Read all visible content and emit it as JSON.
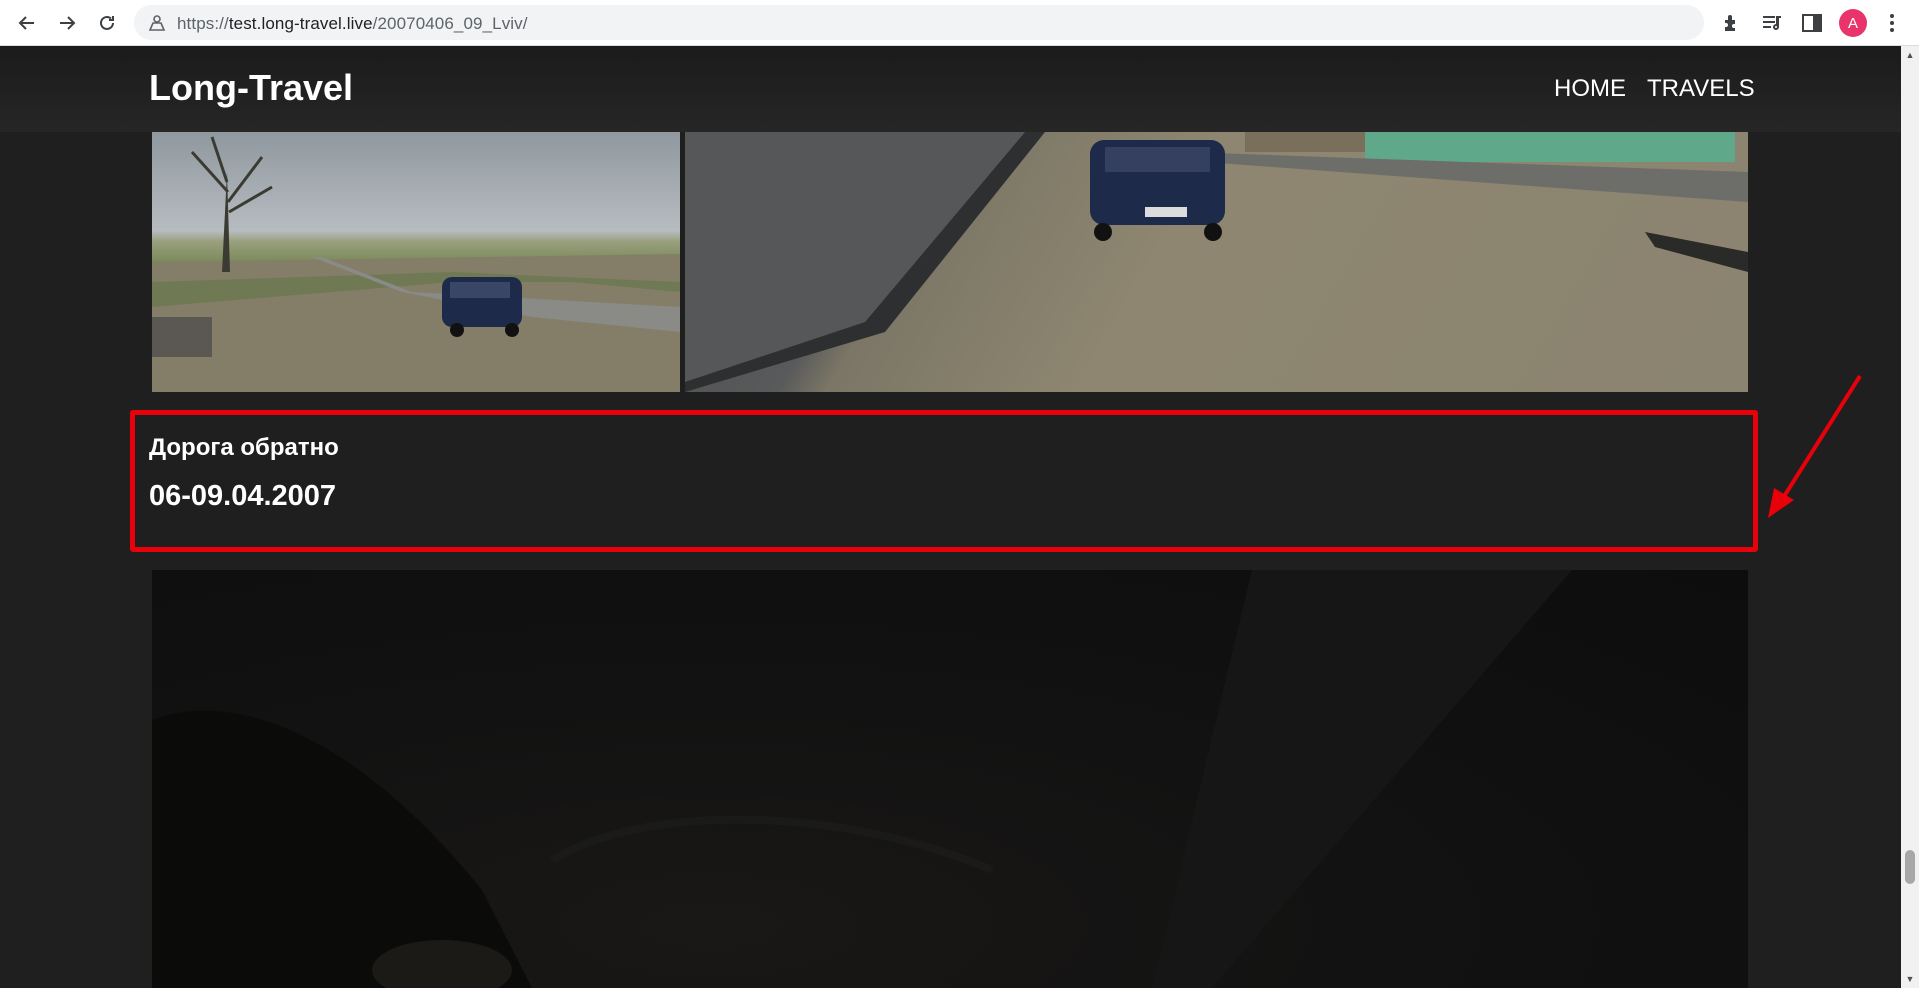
{
  "browser": {
    "url_prefix": "https://",
    "url_host": "test.long-travel.live",
    "url_path": "/20070406_09_Lviv/",
    "profile_initial": "A"
  },
  "header": {
    "brand": "Long-Travel",
    "nav": [
      {
        "label": "HOME"
      },
      {
        "label": "TRAVELS"
      }
    ]
  },
  "section": {
    "title": "Дорога обратно",
    "date": "06-09.04.2007"
  },
  "colors": {
    "highlight": "#e8000b",
    "page_bg": "#1f1f1f",
    "avatar": "#e8336b"
  }
}
